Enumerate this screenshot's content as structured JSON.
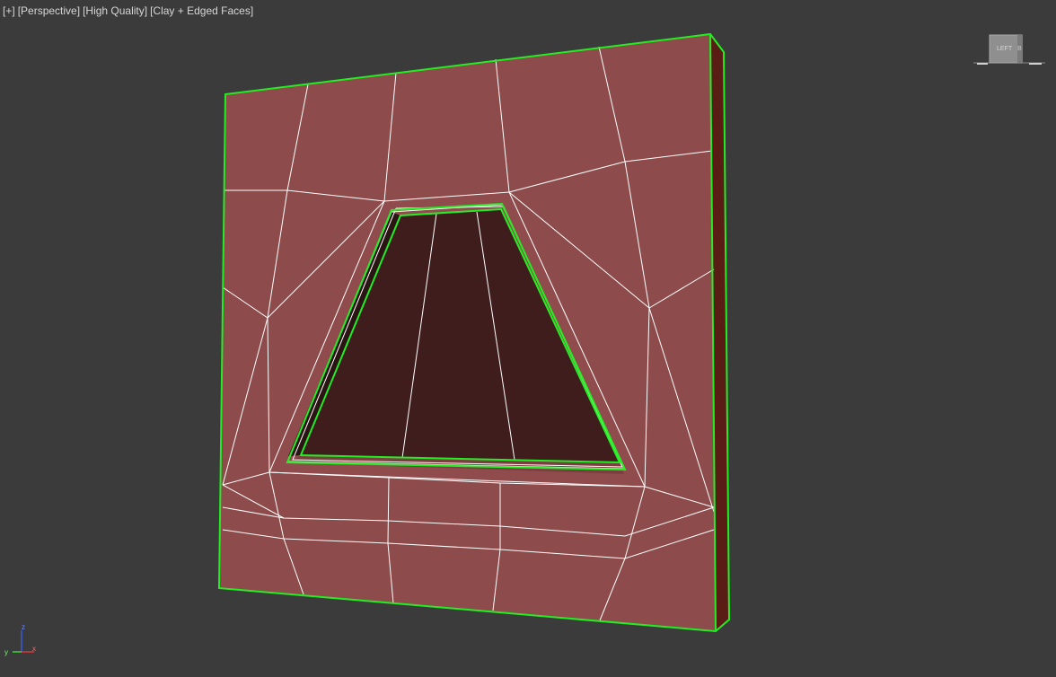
{
  "viewport": {
    "label_plus": "[+]",
    "label_view": "[Perspective]",
    "label_quality": "[High Quality]",
    "label_shading": "[Clay + Edged Faces]"
  },
  "viewcube": {
    "face_label": "LEFT",
    "side_label": "B"
  },
  "axis_gizmo": {
    "x_label": "x",
    "y_label": "y",
    "z_label": "z"
  },
  "colors": {
    "background": "#3b3b3b",
    "clay": "#8d4b4b",
    "clay_dark": "#3f1d1d",
    "selection": "#22ee22",
    "edges": "#ffffff",
    "side": "#5a1d16"
  }
}
